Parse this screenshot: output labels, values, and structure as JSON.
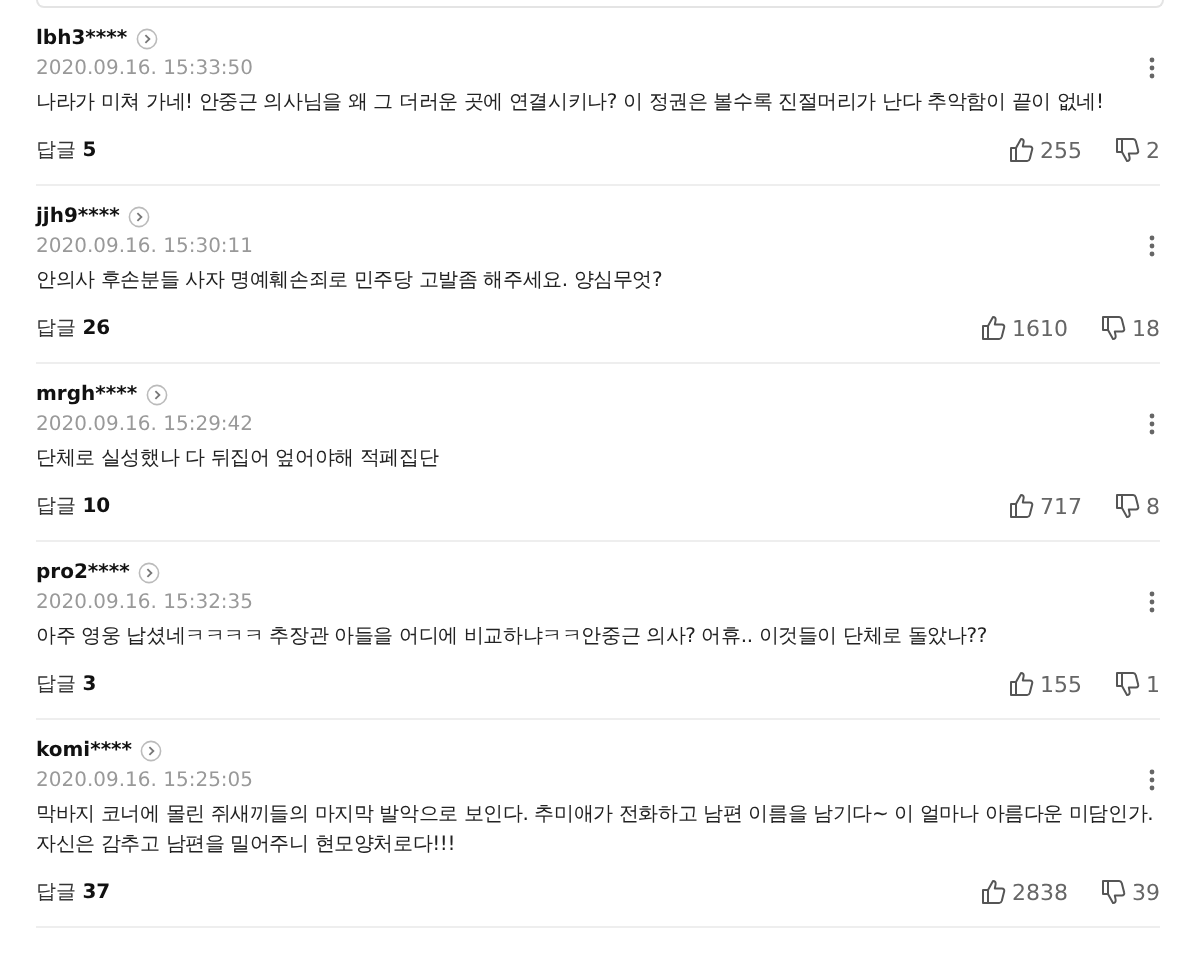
{
  "comments": [
    {
      "user": "lbh3****",
      "date": "2020.09.16. 15:33:50",
      "text": "나라가 미쳐 가네! 안중근 의사님을 왜 그 더러운 곳에 연결시키나? 이 정권은 볼수록 진절머리가 난다 추악함이 끝이 없네!",
      "replies": "답글 **5**",
      "likes": "255",
      "dislikes": "2"
    },
    {
      "user": "jjh9****",
      "date": "2020.09.16. 15:30:11",
      "text": "안의사 후손분들 사자 명예훼손죄로 민주당 고발좀 해주세요. 양심무엇?",
      "replies": "답글 **26**",
      "likes": "1610",
      "dislikes": "18"
    },
    {
      "user": "mrgh****",
      "date": "2020.09.16. 15:29:42",
      "text": "단체로 실성했나 다 뒤집어 엎어야해 적페집단",
      "replies": "답글 **10**",
      "likes": "717",
      "dislikes": "8"
    },
    {
      "user": "pro2****",
      "date": "2020.09.16. 15:32:35",
      "text": "아주 영웅 납셨네ㅋㅋㅋㅋ 추장관 아들을 어디에 비교하냐ㅋㅋ안중근 의사? 어휴.. 이것들이 단체로 돌았나??",
      "replies": "답글 **3**",
      "likes": "155",
      "dislikes": "1"
    },
    {
      "user": "komi****",
      "date": "2020.09.16. 15:25:05",
      "text": "막바지 코너에 몰린 쥐새끼들의 마지막 발악으로 보인다. 추미애가 전화하고 남편 이름을 남기다~ 이 얼마나 아름다운 미담인가. 자신은 감추고 남편을 밀어주니 현모양처로다!!!",
      "replies": "답글 **37**",
      "likes": "2838",
      "dislikes": "39"
    }
  ]
}
